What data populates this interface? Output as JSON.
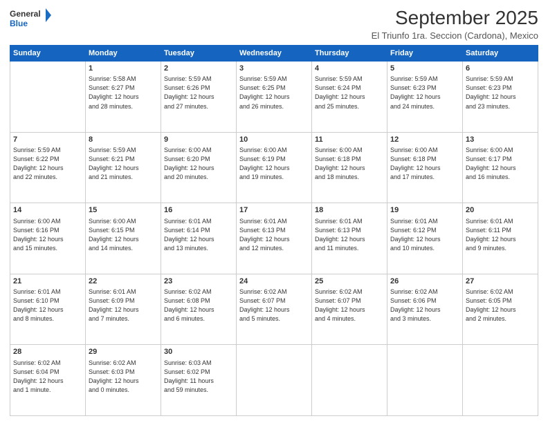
{
  "logo": {
    "line1": "General",
    "line2": "Blue"
  },
  "title": "September 2025",
  "subtitle": "El Triunfo 1ra. Seccion (Cardona), Mexico",
  "headers": [
    "Sunday",
    "Monday",
    "Tuesday",
    "Wednesday",
    "Thursday",
    "Friday",
    "Saturday"
  ],
  "weeks": [
    [
      {
        "day": "",
        "info": ""
      },
      {
        "day": "1",
        "info": "Sunrise: 5:58 AM\nSunset: 6:27 PM\nDaylight: 12 hours\nand 28 minutes."
      },
      {
        "day": "2",
        "info": "Sunrise: 5:59 AM\nSunset: 6:26 PM\nDaylight: 12 hours\nand 27 minutes."
      },
      {
        "day": "3",
        "info": "Sunrise: 5:59 AM\nSunset: 6:25 PM\nDaylight: 12 hours\nand 26 minutes."
      },
      {
        "day": "4",
        "info": "Sunrise: 5:59 AM\nSunset: 6:24 PM\nDaylight: 12 hours\nand 25 minutes."
      },
      {
        "day": "5",
        "info": "Sunrise: 5:59 AM\nSunset: 6:23 PM\nDaylight: 12 hours\nand 24 minutes."
      },
      {
        "day": "6",
        "info": "Sunrise: 5:59 AM\nSunset: 6:23 PM\nDaylight: 12 hours\nand 23 minutes."
      }
    ],
    [
      {
        "day": "7",
        "info": "Sunrise: 5:59 AM\nSunset: 6:22 PM\nDaylight: 12 hours\nand 22 minutes."
      },
      {
        "day": "8",
        "info": "Sunrise: 5:59 AM\nSunset: 6:21 PM\nDaylight: 12 hours\nand 21 minutes."
      },
      {
        "day": "9",
        "info": "Sunrise: 6:00 AM\nSunset: 6:20 PM\nDaylight: 12 hours\nand 20 minutes."
      },
      {
        "day": "10",
        "info": "Sunrise: 6:00 AM\nSunset: 6:19 PM\nDaylight: 12 hours\nand 19 minutes."
      },
      {
        "day": "11",
        "info": "Sunrise: 6:00 AM\nSunset: 6:18 PM\nDaylight: 12 hours\nand 18 minutes."
      },
      {
        "day": "12",
        "info": "Sunrise: 6:00 AM\nSunset: 6:18 PM\nDaylight: 12 hours\nand 17 minutes."
      },
      {
        "day": "13",
        "info": "Sunrise: 6:00 AM\nSunset: 6:17 PM\nDaylight: 12 hours\nand 16 minutes."
      }
    ],
    [
      {
        "day": "14",
        "info": "Sunrise: 6:00 AM\nSunset: 6:16 PM\nDaylight: 12 hours\nand 15 minutes."
      },
      {
        "day": "15",
        "info": "Sunrise: 6:00 AM\nSunset: 6:15 PM\nDaylight: 12 hours\nand 14 minutes."
      },
      {
        "day": "16",
        "info": "Sunrise: 6:01 AM\nSunset: 6:14 PM\nDaylight: 12 hours\nand 13 minutes."
      },
      {
        "day": "17",
        "info": "Sunrise: 6:01 AM\nSunset: 6:13 PM\nDaylight: 12 hours\nand 12 minutes."
      },
      {
        "day": "18",
        "info": "Sunrise: 6:01 AM\nSunset: 6:13 PM\nDaylight: 12 hours\nand 11 minutes."
      },
      {
        "day": "19",
        "info": "Sunrise: 6:01 AM\nSunset: 6:12 PM\nDaylight: 12 hours\nand 10 minutes."
      },
      {
        "day": "20",
        "info": "Sunrise: 6:01 AM\nSunset: 6:11 PM\nDaylight: 12 hours\nand 9 minutes."
      }
    ],
    [
      {
        "day": "21",
        "info": "Sunrise: 6:01 AM\nSunset: 6:10 PM\nDaylight: 12 hours\nand 8 minutes."
      },
      {
        "day": "22",
        "info": "Sunrise: 6:01 AM\nSunset: 6:09 PM\nDaylight: 12 hours\nand 7 minutes."
      },
      {
        "day": "23",
        "info": "Sunrise: 6:02 AM\nSunset: 6:08 PM\nDaylight: 12 hours\nand 6 minutes."
      },
      {
        "day": "24",
        "info": "Sunrise: 6:02 AM\nSunset: 6:07 PM\nDaylight: 12 hours\nand 5 minutes."
      },
      {
        "day": "25",
        "info": "Sunrise: 6:02 AM\nSunset: 6:07 PM\nDaylight: 12 hours\nand 4 minutes."
      },
      {
        "day": "26",
        "info": "Sunrise: 6:02 AM\nSunset: 6:06 PM\nDaylight: 12 hours\nand 3 minutes."
      },
      {
        "day": "27",
        "info": "Sunrise: 6:02 AM\nSunset: 6:05 PM\nDaylight: 12 hours\nand 2 minutes."
      }
    ],
    [
      {
        "day": "28",
        "info": "Sunrise: 6:02 AM\nSunset: 6:04 PM\nDaylight: 12 hours\nand 1 minute."
      },
      {
        "day": "29",
        "info": "Sunrise: 6:02 AM\nSunset: 6:03 PM\nDaylight: 12 hours\nand 0 minutes."
      },
      {
        "day": "30",
        "info": "Sunrise: 6:03 AM\nSunset: 6:02 PM\nDaylight: 11 hours\nand 59 minutes."
      },
      {
        "day": "",
        "info": ""
      },
      {
        "day": "",
        "info": ""
      },
      {
        "day": "",
        "info": ""
      },
      {
        "day": "",
        "info": ""
      }
    ]
  ]
}
